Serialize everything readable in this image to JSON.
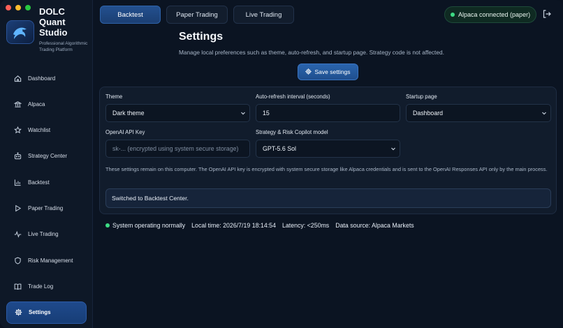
{
  "brand": {
    "name": "DOLC Quant Studio",
    "tagline": "Professional Algorithmic Trading Platform",
    "logo_icon": "dolphin-icon"
  },
  "sidebar": {
    "items": [
      {
        "label": "Dashboard",
        "icon": "home-icon"
      },
      {
        "label": "Alpaca",
        "icon": "bank-icon"
      },
      {
        "label": "Watchlist",
        "icon": "star-icon"
      },
      {
        "label": "Strategy Center",
        "icon": "robot-icon"
      },
      {
        "label": "Backtest",
        "icon": "chart-icon"
      },
      {
        "label": "Paper Trading",
        "icon": "play-icon"
      },
      {
        "label": "Live Trading",
        "icon": "pulse-icon"
      },
      {
        "label": "Risk Management",
        "icon": "shield-icon"
      },
      {
        "label": "Trade Log",
        "icon": "book-icon"
      },
      {
        "label": "Settings",
        "icon": "gear-icon"
      }
    ],
    "active": "Settings"
  },
  "topbar": {
    "tabs": [
      {
        "label": "Backtest"
      },
      {
        "label": "Paper Trading"
      },
      {
        "label": "Live Trading"
      }
    ],
    "active_tab": "Backtest",
    "connection": "Alpaca connected (paper)"
  },
  "main": {
    "title": "Settings",
    "subtitle": "Manage local preferences such as theme, auto-refresh, and startup page. Strategy code is not affected.",
    "save_label": "Save settings"
  },
  "form": {
    "theme": {
      "label": "Theme",
      "value": "Dark theme"
    },
    "refresh": {
      "label": "Auto-refresh interval (seconds)",
      "value": "15"
    },
    "startup": {
      "label": "Startup page",
      "value": "Dashboard"
    },
    "openai_key": {
      "label": "OpenAI API Key",
      "placeholder": "sk-... (encrypted using system secure storage)"
    },
    "model": {
      "label": "Strategy & Risk Copilot model",
      "value": "GPT-5.6 Sol"
    },
    "note": "These settings remain on this computer. The OpenAI API key is encrypted with system secure storage like Alpaca credentials and is sent to the OpenAI Responses API only by the main process.",
    "status": "Switched to Backtest Center."
  },
  "footer": {
    "system": "System operating normally",
    "time": "Local time: 2026/7/19 18:14:54",
    "latency": "Latency: <250ms",
    "source": "Data source: Alpaca Markets"
  },
  "colors": {
    "accent": "#2a64ad",
    "status_ok": "#3ddc84",
    "background": "#0b1422"
  }
}
